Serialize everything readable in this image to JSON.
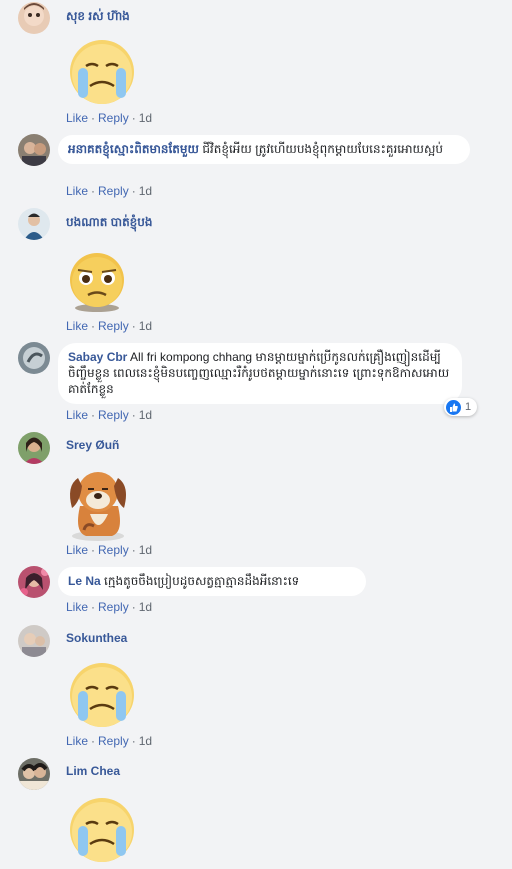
{
  "comments": [
    {
      "name": "សុខ រស់ ហ៊ាង",
      "text": "",
      "sticker": "crying-face-sticker",
      "actions": {
        "like": "Like",
        "reply": "Reply",
        "time": "1d"
      }
    },
    {
      "name": "អនាគតខ្ញុំស្មោះពិតមានតែមួយ",
      "text": "ជីវិតខ្ញុំអើយ ត្រូវហើយបងខ្ញុំពុកម្ដាយបែនេះគួរអោយស្អប់",
      "actions": {
        "like": "Like",
        "reply": "Reply",
        "time": "1d"
      }
    },
    {
      "name": "បងណាត បាត់ខ្ញុំបង",
      "text": "",
      "sticker": "pleading-face-sticker",
      "actions": {
        "like": "Like",
        "reply": "Reply",
        "time": "1d"
      }
    },
    {
      "name": "Sabay Cbr",
      "text": "All fri kompong chhang មានម្ដាយម្នាក់ប្រើកូនលក់គ្រឿងញៀនដើម្បីចិញ្ចឹមខ្លួន ពេលនេះខ្ញុំមិនបញ្ចេញឈ្មោះរឺកំរូបថតម្ដាយម្នាក់នោះទេ ព្រោះទុកឱកាសអោយគាត់កែខ្លួន",
      "reaction_count": "1",
      "actions": {
        "like": "Like",
        "reply": "Reply",
        "time": "1d"
      }
    },
    {
      "name": "Srey Øuñ",
      "text": "",
      "sticker": "sad-puppy-sticker",
      "actions": {
        "like": "Like",
        "reply": "Reply",
        "time": "1d"
      }
    },
    {
      "name": "Le Na",
      "text": "ក្មេងតូចចឹងប្រៀបដូចសត្វត្មាត្មានដឹងអីនោះទេ",
      "actions": {
        "like": "Like",
        "reply": "Reply",
        "time": "1d"
      }
    },
    {
      "name": "Sokunthea",
      "text": "",
      "sticker": "crying-face-sticker",
      "actions": {
        "like": "Like",
        "reply": "Reply",
        "time": "1d"
      }
    },
    {
      "name": "Lim Chea",
      "text": "",
      "sticker": "crying-face-sticker",
      "actions": {
        "like": "",
        "reply": "",
        "time": ""
      }
    }
  ],
  "colors": {
    "name": "#385898",
    "link": "#4267b2",
    "bubble": "#ffffff",
    "background": "#f2f3f5",
    "like_blue": "#1877f2"
  }
}
